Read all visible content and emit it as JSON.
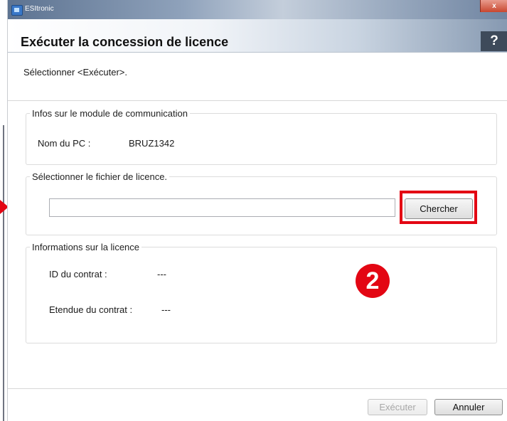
{
  "window": {
    "title": "ESItronic",
    "close": "x"
  },
  "dialog": {
    "title": "Exécuter la concession de licence",
    "help": "?"
  },
  "instruction": "Sélectionner <Exécuter>.",
  "communication_module": {
    "legend": "Infos sur le module de communication",
    "pc_name_label": "Nom du PC :",
    "pc_name_value": "BRUZ1342"
  },
  "license_file": {
    "legend": "Sélectionner le fichier de licence.",
    "path_value": "",
    "browse_label": "Chercher"
  },
  "license_info": {
    "legend": "Informations sur la licence",
    "contract_id_label": "ID du contrat :",
    "contract_id_value": "---",
    "contract_scope_label": "Etendue du contrat :",
    "contract_scope_value": "---"
  },
  "annotation": {
    "step_number": "2",
    "color": "#e30613"
  },
  "footer": {
    "execute_label": "Exécuter",
    "cancel_label": "Annuler"
  }
}
